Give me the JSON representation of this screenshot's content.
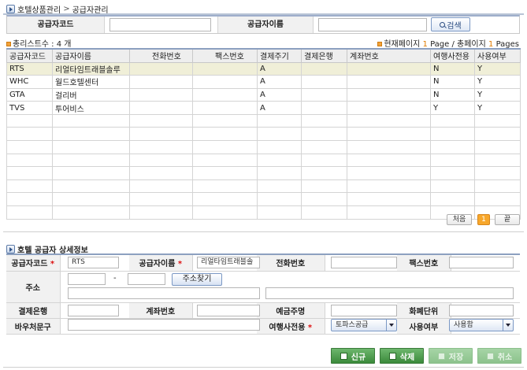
{
  "breadcrumb": {
    "parent": "호텔상품관리",
    "separator": ">",
    "current": "공급자관리"
  },
  "search": {
    "code_label": "공급자코드",
    "code_value": "",
    "name_label": "공급자이름",
    "name_value": "",
    "button_label": "검색"
  },
  "list": {
    "count_label": "총리스트수 :",
    "count_value": "4 개",
    "page_prefix": "현재페이지",
    "current_page": "1",
    "page_mid": "Page / 총페이지",
    "total_pages": "1",
    "page_suffix": "Pages"
  },
  "grid": {
    "columns": [
      "공급자코드",
      "공급자이름",
      "전화번호",
      "팩스번호",
      "결제주기",
      "결제은행",
      "계좌번호",
      "여행사전용",
      "사용여부"
    ],
    "rows": [
      [
        "RTS",
        "리얼타임트래블솔루",
        "",
        "",
        "A",
        "",
        "",
        "N",
        "Y"
      ],
      [
        "WHC",
        "월드호텔센터",
        "",
        "",
        "A",
        "",
        "",
        "N",
        "Y"
      ],
      [
        "GTA",
        "걸리버",
        "",
        "",
        "A",
        "",
        "",
        "N",
        "Y"
      ],
      [
        "TVS",
        "투어비스",
        "",
        "",
        "A",
        "",
        "",
        "Y",
        "Y"
      ]
    ],
    "empty_rows": 8
  },
  "pager": {
    "first": "처음",
    "current": "1",
    "last": "끝"
  },
  "detail": {
    "title": "호텔 공급자 상세정보",
    "code_label": "공급자코드",
    "code_value": "RTS",
    "name_label": "공급자이름",
    "name_value": "리얼타임트래블솔",
    "phone_label": "전화번호",
    "phone_value": "",
    "fax_label": "팩스번호",
    "fax_value": "",
    "address_label": "주소",
    "zip_dash": "-",
    "address_button": "주소찾기",
    "bank_label": "결제은행",
    "bank_value": "",
    "account_label": "계좌번호",
    "account_value": "",
    "holder_label": "예금주명",
    "holder_value": "",
    "currency_label": "화폐단위",
    "currency_value": "",
    "voucher_label": "바우처문구",
    "voucher_value": "",
    "agency_label": "여행사전용",
    "agency_value": "토파스공급",
    "use_label": "사용여부",
    "use_value": "사용함",
    "required_mark": "*"
  },
  "actions": {
    "new": "신규",
    "delete": "삭제",
    "save": "저장",
    "cancel": "취소"
  },
  "colors": {
    "accent_orange": "#f7a72b",
    "action_green": "#3b8a3b",
    "selected_row": "#f0efd8"
  }
}
